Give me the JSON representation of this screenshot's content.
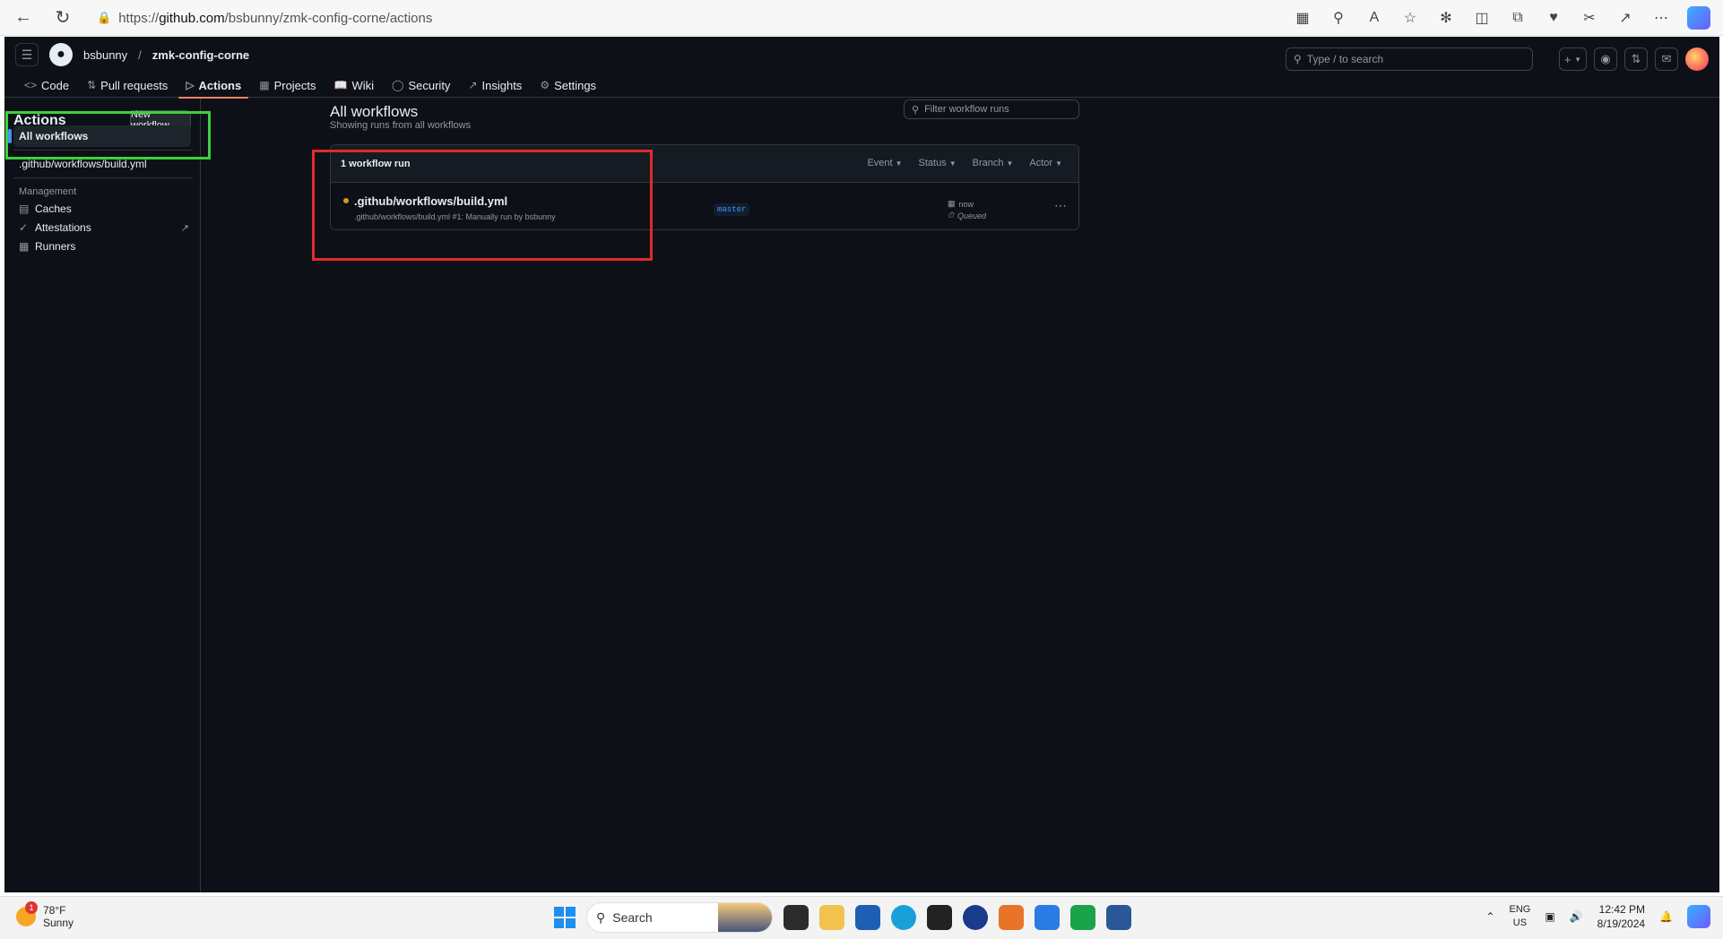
{
  "browser": {
    "url_prefix": "https://",
    "url_host": "github.com",
    "url_path": "/bsbunny/zmk-config-corne/actions"
  },
  "header": {
    "owner": "bsbunny",
    "separator": "/",
    "repo": "zmk-config-corne",
    "search_placeholder": "Type / to search",
    "plus_label": "+"
  },
  "repo_nav": {
    "tabs": [
      {
        "label": "Code",
        "icon": "code-icon"
      },
      {
        "label": "Pull requests",
        "icon": "pull-request-icon"
      },
      {
        "label": "Actions",
        "icon": "play-icon"
      },
      {
        "label": "Projects",
        "icon": "table-icon"
      },
      {
        "label": "Wiki",
        "icon": "book-icon"
      },
      {
        "label": "Security",
        "icon": "shield-icon"
      },
      {
        "label": "Insights",
        "icon": "graph-icon"
      },
      {
        "label": "Settings",
        "icon": "gear-icon"
      }
    ],
    "active": "Actions"
  },
  "sidebar": {
    "title": "Actions",
    "new_workflow": "New workflow",
    "all_workflows": "All workflows",
    "workflow_item": ".github/workflows/build.yml",
    "management_heading": "Management",
    "links": [
      {
        "label": "Caches",
        "icon": "cache-icon"
      },
      {
        "label": "Attestations",
        "icon": "check-circle-icon",
        "external": "↗"
      },
      {
        "label": "Runners",
        "icon": "server-icon"
      }
    ]
  },
  "main": {
    "title": "All workflows",
    "subtitle": "Showing runs from all workflows",
    "filter_placeholder": "Filter workflow runs",
    "runs_count": "1 workflow run",
    "filters": [
      "Event",
      "Status",
      "Branch",
      "Actor"
    ],
    "run": {
      "title": ".github/workflows/build.yml",
      "meta": ".github/workflows/build.yml #1: Manually run by bsbunny",
      "branch": "master",
      "when": "now",
      "status": "Queued",
      "status_color": "#d29922"
    }
  },
  "taskbar": {
    "weather_temp": "78°F",
    "weather_desc": "Sunny",
    "weather_badge": "1",
    "search_label": "Search",
    "lang_top": "ENG",
    "lang_bottom": "US",
    "time": "12:42 PM",
    "date": "8/19/2024"
  },
  "colors": {
    "accent_tab": "#f78166",
    "annotation_green": "#3dd13d",
    "annotation_red": "#e02b2b",
    "link_blue": "#4493f8"
  }
}
